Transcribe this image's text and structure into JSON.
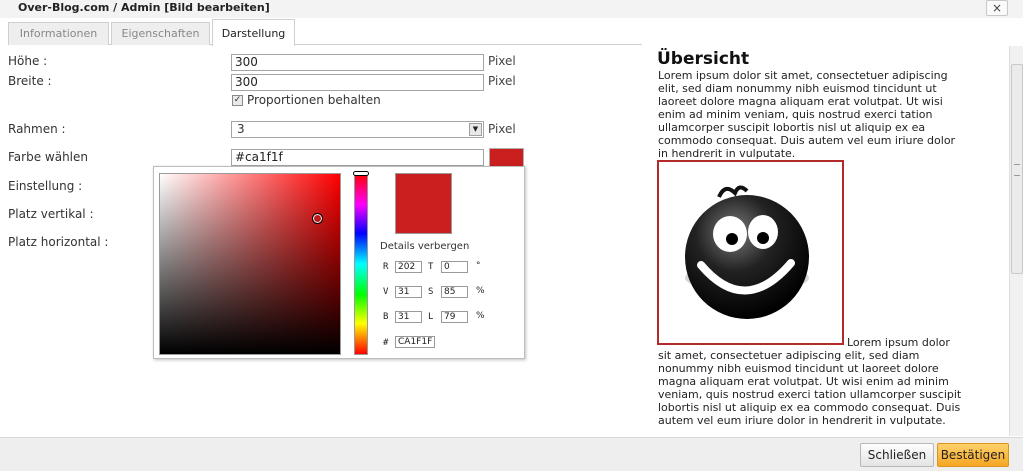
{
  "window": {
    "title": "Over-Blog.com / Admin [Bild bearbeiten]",
    "close_symbol": "×"
  },
  "tabs": [
    {
      "label": "Informationen",
      "active": false
    },
    {
      "label": "Eigenschaften",
      "active": false
    },
    {
      "label": "Darstellung",
      "active": true
    }
  ],
  "form": {
    "height_label": "Höhe :",
    "height_value": "300",
    "width_label": "Breite :",
    "width_value": "300",
    "unit_pixel": "Pixel",
    "keep_proportions_label": "Proportionen behalten",
    "keep_proportions_checked": true,
    "border_label": "Rahmen :",
    "border_value": "3",
    "color_label": "Farbe wählen",
    "color_value": "#ca1f1f",
    "setting_label": "Einstellung :",
    "vspace_label": "Platz vertikal :",
    "hspace_label": "Platz horizontal :"
  },
  "color_picker": {
    "selected_color": "#ca1f1f",
    "hue_color": "#ff0000",
    "details_toggle": "Details verbergen",
    "fields": {
      "R": "202",
      "T": "0",
      "T_unit": "°",
      "V": "31",
      "S": "85",
      "S_unit": "%",
      "B": "31",
      "L": "79",
      "L_unit": "%",
      "hash_label": "#",
      "hex": "CA1F1F"
    }
  },
  "preview": {
    "title": "Übersicht",
    "paragraph": "Lorem ipsum dolor sit amet, consectetuer adipiscing elit, sed diam nonummy nibh euismod tincidunt ut laoreet dolore magna aliquam erat volutpat. Ut wisi enim ad minim veniam, quis nostrud exerci tation ullamcorper suscipit lobortis nisl ut aliquip ex ea commodo consequat. Duis autem vel eum iriure dolor in hendrerit in vulputate.",
    "image_border_color": "#b22a2a"
  },
  "footer": {
    "close_label": "Schließen",
    "confirm_label": "Bestätigen"
  },
  "colors": {
    "accent": "#f5a623",
    "swatch": "#ca1f1f"
  }
}
